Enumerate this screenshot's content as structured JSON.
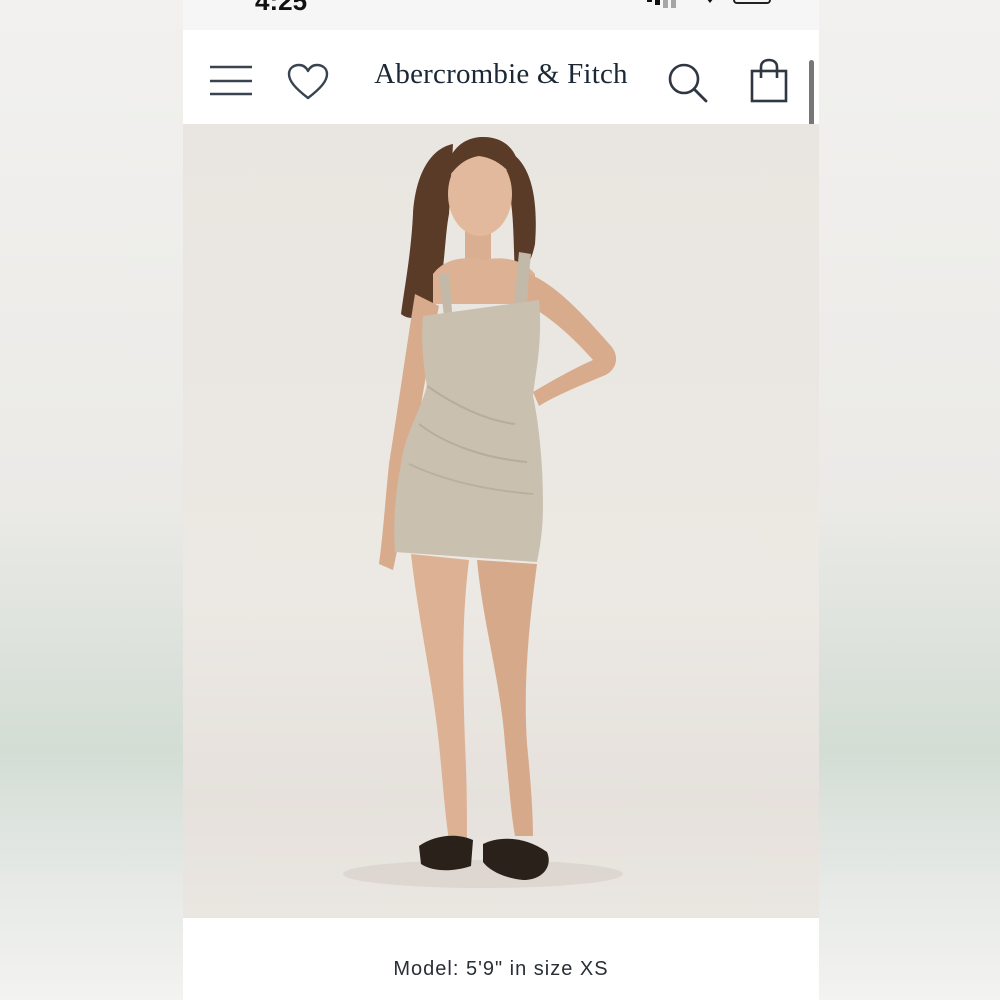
{
  "status_bar": {
    "time": "4:25"
  },
  "header": {
    "brand": "Abercrombie & Fitch",
    "icons": {
      "menu": "menu-icon",
      "wishlist": "heart-icon",
      "search": "search-icon",
      "bag": "shopping-bag-icon"
    }
  },
  "product": {
    "image": "model-in-linen-mini-dress",
    "model_caption": "Model: 5'9\" in size XS"
  },
  "colors": {
    "brand_navy": "#1c2836",
    "dress": "#c9c0b0",
    "background": "#ece8e3"
  }
}
